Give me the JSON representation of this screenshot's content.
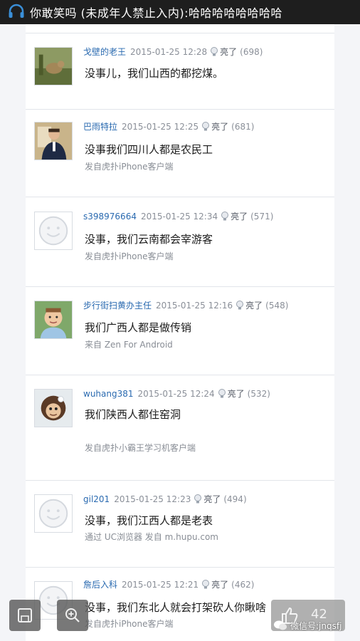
{
  "header": {
    "title": "你敢笑吗 (未成年人禁止入内):哈哈哈哈哈哈哈哈"
  },
  "comments": [
    {
      "user": "戈壁的老王",
      "time": "2015-01-25 12:28",
      "light_label": "亮了",
      "light_count": "(698)",
      "text": "没事儿，我们山西的都挖煤。",
      "source": ""
    },
    {
      "user": "巴雨特拉",
      "time": "2015-01-25 12:25",
      "light_label": "亮了",
      "light_count": "(681)",
      "text": "没事我们四川人都是农民工",
      "source": "发自虎扑iPhone客户端"
    },
    {
      "user": "s398976664",
      "time": "2015-01-25 12:34",
      "light_label": "亮了",
      "light_count": "(571)",
      "text": "没事，我们云南都会宰游客",
      "source": "发自虎扑iPhone客户端"
    },
    {
      "user": "步行街扫黄办主任",
      "time": "2015-01-25 12:16",
      "light_label": "亮了",
      "light_count": "(548)",
      "text": "我们广西人都是做传销",
      "source": "来自 Zen For Android"
    },
    {
      "user": "wuhang381",
      "time": "2015-01-25 12:24",
      "light_label": "亮了",
      "light_count": "(532)",
      "text": "我们陕西人都住窑洞",
      "source": "发自虎扑小霸王学习机客户端"
    },
    {
      "user": "gil201",
      "time": "2015-01-25 12:23",
      "light_label": "亮了",
      "light_count": "(494)",
      "text": "没事，我们江西人都是老表",
      "source": "通过 UC浏览器 发自 m.hupu.com"
    },
    {
      "user": "詹后入科",
      "time": "2015-01-25 12:21",
      "light_label": "亮了",
      "light_count": "(462)",
      "text": "没事，我们东北人就会打架砍人你瞅啥",
      "source": "发自虎扑iPhone客户端"
    }
  ],
  "toolbar": {
    "like_count": "42"
  },
  "watermark": {
    "text": "微信号:jnqsfj"
  },
  "colors": {
    "username": "#2a6ab0",
    "topbar": "#1e1e1e",
    "page_bg": "#f4f5f8"
  }
}
